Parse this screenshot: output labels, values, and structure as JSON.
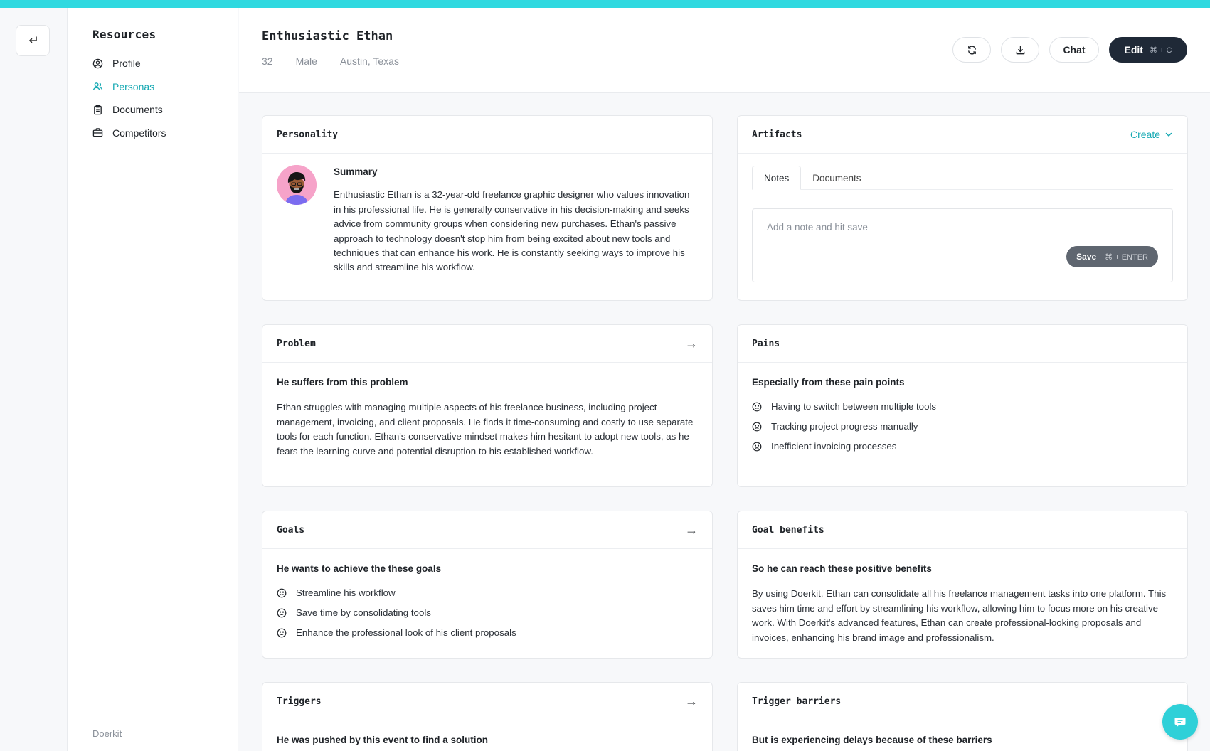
{
  "sidebar": {
    "title": "Resources",
    "items": [
      {
        "label": "Profile",
        "icon": "user-circle-icon"
      },
      {
        "label": "Personas",
        "icon": "users-icon"
      },
      {
        "label": "Documents",
        "icon": "clipboard-icon"
      },
      {
        "label": "Competitors",
        "icon": "briefcase-icon"
      }
    ],
    "active": "Personas",
    "footer": "Doerkit"
  },
  "header": {
    "title": "Enthusiastic Ethan",
    "age": "32",
    "gender": "Male",
    "location": "Austin, Texas",
    "chat_label": "Chat",
    "edit_label": "Edit",
    "edit_shortcut": "⌘ + C"
  },
  "personality": {
    "title": "Personality",
    "subtitle": "Summary",
    "text": "Enthusiastic Ethan is a 32-year-old freelance graphic designer who values innovation in his professional life. He is generally conservative in his decision-making and seeks advice from community groups when considering new purchases. Ethan's passive approach to technology doesn't stop him from being excited about new tools and techniques that can enhance his work. He is constantly seeking ways to improve his skills and streamline his workflow."
  },
  "artifacts": {
    "title": "Artifacts",
    "create_label": "Create",
    "tabs": [
      "Notes",
      "Documents"
    ],
    "note_placeholder": "Add a note and hit save",
    "save_label": "Save",
    "save_shortcut": "⌘ + ENTER"
  },
  "problem": {
    "title": "Problem",
    "subtitle": "He suffers from this problem",
    "text": "Ethan struggles with managing multiple aspects of his freelance business, including project management, invoicing, and client proposals. He finds it time-consuming and costly to use separate tools for each function. Ethan's conservative mindset makes him hesitant to adopt new tools, as he fears the learning curve and potential disruption to his established workflow."
  },
  "pains": {
    "title": "Pains",
    "subtitle": "Especially from these pain points",
    "items": [
      "Having to switch between multiple tools",
      "Tracking project progress manually",
      "Inefficient invoicing processes"
    ]
  },
  "goals": {
    "title": "Goals",
    "subtitle": "He wants to achieve the these goals",
    "items": [
      "Streamline his workflow",
      "Save time by consolidating tools",
      "Enhance the professional look of his client proposals"
    ]
  },
  "goal_benefits": {
    "title": "Goal benefits",
    "subtitle": "So he can reach these positive benefits",
    "text": "By using Doerkit, Ethan can consolidate all his freelance management tasks into one platform. This saves him time and effort by streamlining his workflow, allowing him to focus more on his creative work. With Doerkit's advanced features, Ethan can create professional-looking proposals and invoices, enhancing his brand image and professionalism."
  },
  "triggers": {
    "title": "Triggers",
    "subtitle": "He was pushed by this event to find a solution"
  },
  "trigger_barriers": {
    "title": "Trigger barriers",
    "subtitle": "But is experiencing delays because of these barriers"
  },
  "colors": {
    "accent": "#16a9b3",
    "top_bar": "#2fd9e0",
    "dark_button": "#1f2937"
  }
}
